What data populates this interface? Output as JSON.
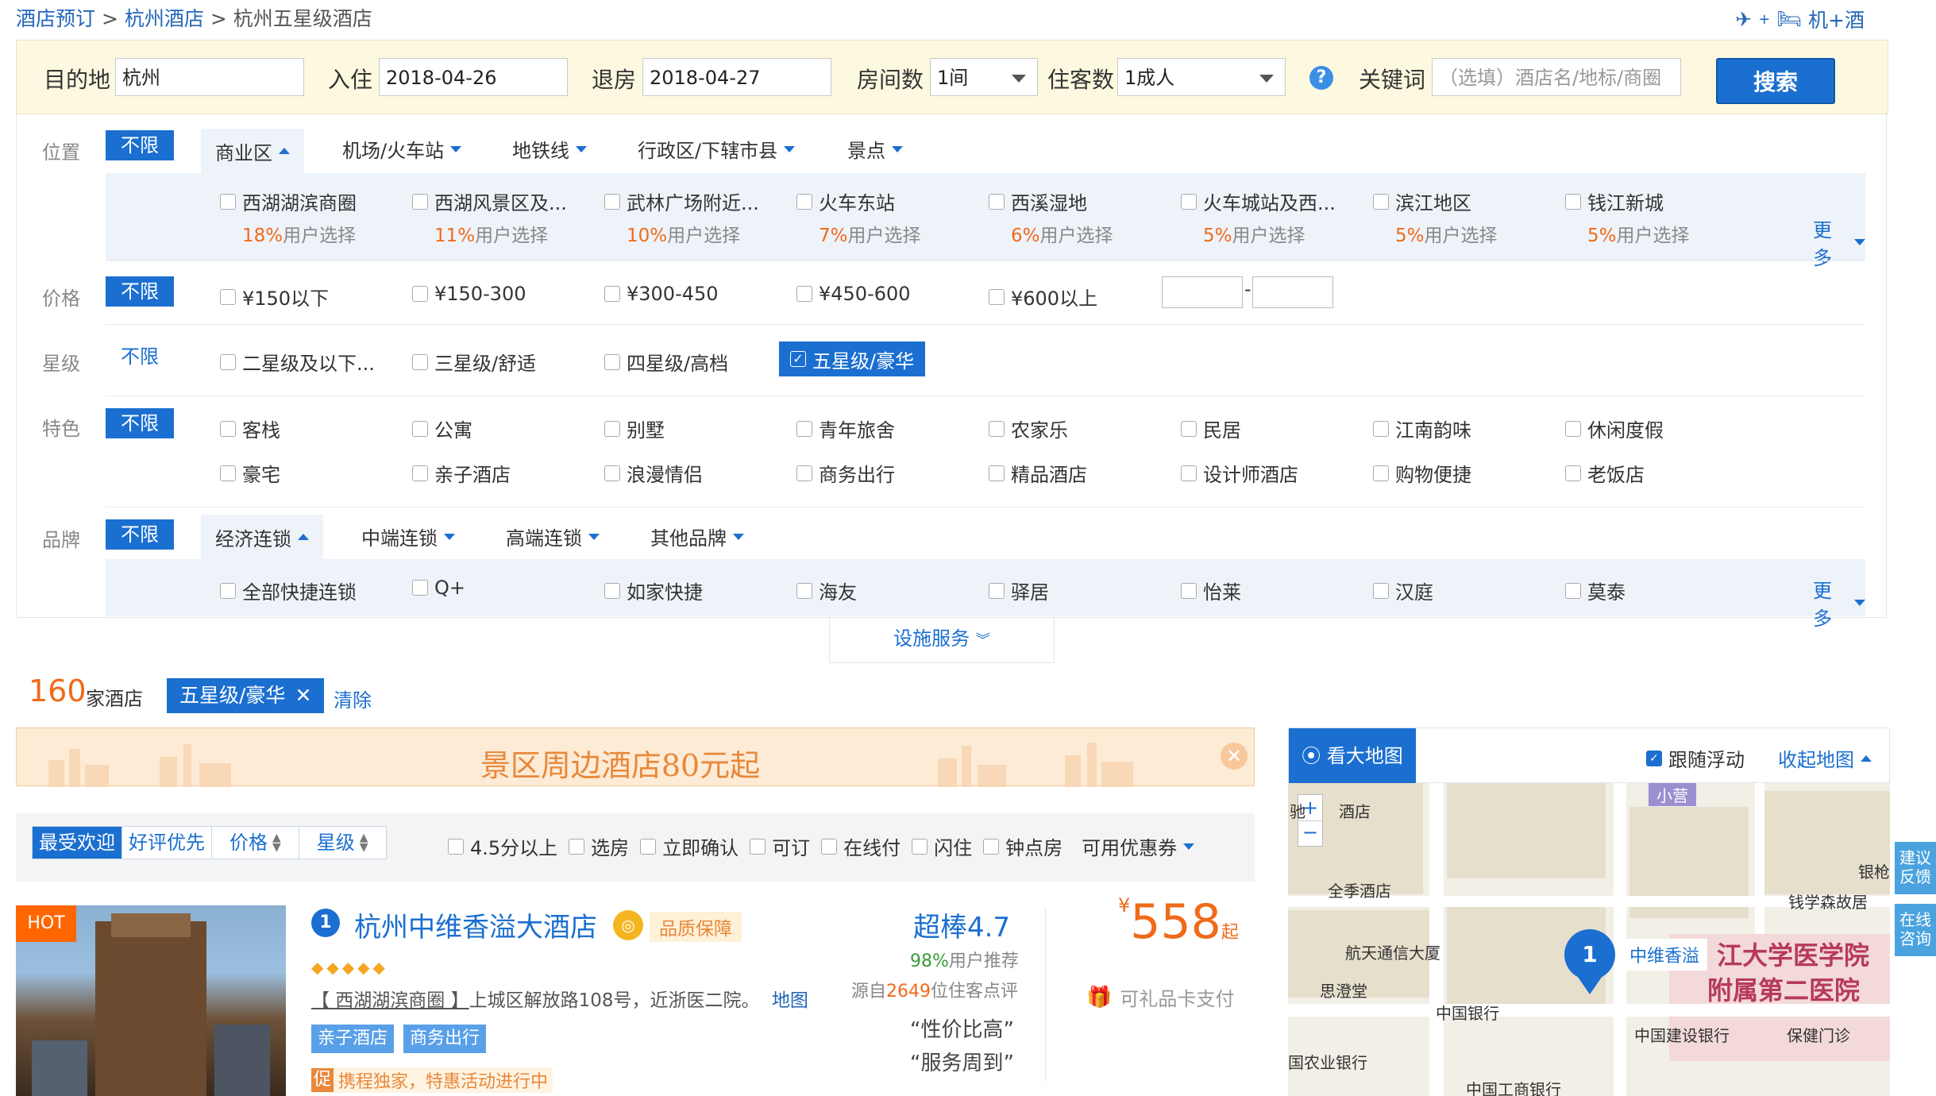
{
  "breadcrumb": {
    "home": "酒店预订",
    "sep1": ">",
    "city": "杭州酒店",
    "sep2": ">",
    "current": "杭州五星级酒店"
  },
  "header": {
    "flight_hotel": "机+酒"
  },
  "search": {
    "destination_label": "目的地",
    "destination": "杭州",
    "checkin_label": "入住",
    "checkin": "2018-04-26",
    "checkout_label": "退房",
    "checkout": "2018-04-27",
    "rooms_label": "房间数",
    "rooms": "1间",
    "guests_label": "住客数",
    "guests": "1成人",
    "help": "?",
    "keyword_label": "关键词",
    "keyword_placeholder": "（选填）酒店名/地标/商圈",
    "submit": "搜索"
  },
  "filters": {
    "unlimited": "不限",
    "location": {
      "label": "位置",
      "tabs": [
        "商业区",
        "机场/火车站",
        "地铁线",
        "行政区/下辖市县",
        "景点"
      ],
      "items": [
        {
          "name": "西湖湖滨商圈",
          "pct": "18%",
          "suffix": "用户选择"
        },
        {
          "name": "西湖风景区及...",
          "pct": "11%",
          "suffix": "用户选择"
        },
        {
          "name": "武林广场附近...",
          "pct": "10%",
          "suffix": "用户选择"
        },
        {
          "name": "火车东站",
          "pct": "7%",
          "suffix": "用户选择"
        },
        {
          "name": "西溪湿地",
          "pct": "6%",
          "suffix": "用户选择"
        },
        {
          "name": "火车城站及西...",
          "pct": "5%",
          "suffix": "用户选择"
        },
        {
          "name": "滨江地区",
          "pct": "5%",
          "suffix": "用户选择"
        },
        {
          "name": "钱江新城",
          "pct": "5%",
          "suffix": "用户选择"
        }
      ],
      "more": "更多"
    },
    "price": {
      "label": "价格",
      "items": [
        "¥150以下",
        "¥150-300",
        "¥300-450",
        "¥450-600",
        "¥600以上"
      ],
      "dash": "-"
    },
    "star": {
      "label": "星级",
      "items": [
        "二星级及以下...",
        "三星级/舒适",
        "四星级/高档",
        "五星级/豪华"
      ],
      "selected": "五星级/豪华"
    },
    "feature": {
      "label": "特色",
      "row1": [
        "客栈",
        "公寓",
        "别墅",
        "青年旅舍",
        "农家乐",
        "民居",
        "江南韵味",
        "休闲度假"
      ],
      "row2": [
        "豪宅",
        "亲子酒店",
        "浪漫情侣",
        "商务出行",
        "精品酒店",
        "设计师酒店",
        "购物便捷",
        "老饭店"
      ]
    },
    "brand": {
      "label": "品牌",
      "tabs": [
        "经济连锁",
        "中端连锁",
        "高端连锁",
        "其他品牌"
      ],
      "items": [
        "全部快捷连锁",
        "Q+",
        "如家快捷",
        "海友",
        "驿居",
        "怡莱",
        "汉庭",
        "莫泰"
      ],
      "more": "更多"
    },
    "facility": "设施服务"
  },
  "results": {
    "count": "160",
    "count_suffix": "家酒店",
    "selected_tag": "五星级/豪华",
    "clear": "清除"
  },
  "banner": {
    "text": "景区周边酒店80元起"
  },
  "sort": {
    "tabs": [
      "最受欢迎",
      "好评优先",
      "价格",
      "星级"
    ],
    "filters": [
      "4.5分以上",
      "选房",
      "立即确认",
      "可订",
      "在线付",
      "闪住",
      "钟点房"
    ],
    "coupon": "可用优惠券"
  },
  "hotel": {
    "badge": "HOT",
    "index": "1",
    "name": "杭州中维香溢大酒店",
    "quality": "品质保障",
    "diamonds": "◆◆◆◆◆",
    "address_area": "【 西湖湖滨商圈 】",
    "address": "上城区解放路108号，近浙医二院。",
    "map_link": "地图",
    "tags": [
      "亲子酒店",
      "商务出行"
    ],
    "promo_icon": "促",
    "promo": "携程独家，特惠活动进行中",
    "rating": "超棒4.7",
    "recommend_pct": "98%",
    "recommend_suffix": "用户推荐",
    "source_prefix": "源自",
    "review_count": "2649",
    "source_suffix": "位住客点评",
    "quote1": "“性价比高”",
    "quote2": "“服务周到”",
    "currency": "¥",
    "price": "558",
    "price_suffix": "起",
    "gift": "可礼品卡支付"
  },
  "map": {
    "view_large": "看大地图",
    "follow": "跟随浮动",
    "collapse": "收起地图",
    "labels": [
      "驰",
      "酒店",
      "全季酒店",
      "航天通信大厦",
      "思澄堂",
      "中国银行",
      "国农业银行",
      "中国工商银行",
      "中国建设银行",
      "保健门诊",
      "钱学森故居",
      "银枪",
      "小营"
    ],
    "pin_number": "1",
    "pin_label": "中维香溢",
    "hospital1": "江大学医学院",
    "hospital2": "附属第二医院"
  },
  "side": {
    "feedback": "建议反馈",
    "consult": "在线咨询"
  },
  "colors": {
    "primary": "#1a6fd0",
    "price": "#f06a1a",
    "banner_bg": "#fdebd6"
  }
}
